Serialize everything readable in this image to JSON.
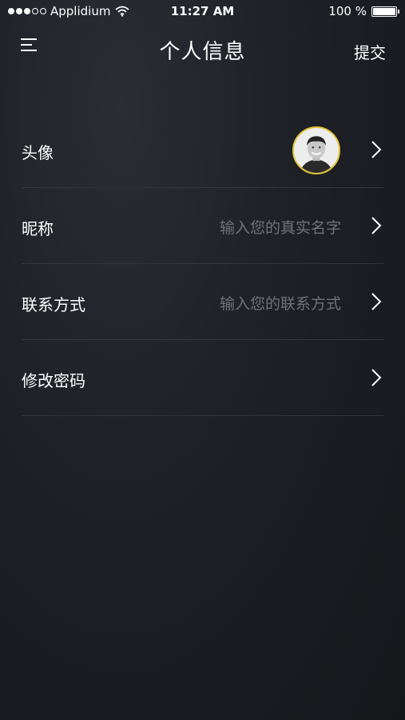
{
  "status_bar": {
    "carrier": "Applidium",
    "time": "11:27 AM",
    "battery": "100 %"
  },
  "nav": {
    "title": "个人信息",
    "submit_label": "提交",
    "menu_icon": "hamburger-icon"
  },
  "rows": [
    {
      "label": "头像",
      "value": "",
      "type": "avatar"
    },
    {
      "label": "昵称",
      "placeholder": "输入您的真实名字"
    },
    {
      "label": "联系方式",
      "placeholder": "输入您的联系方式"
    },
    {
      "label": "修改密码",
      "value": ""
    }
  ],
  "colors": {
    "accent": "#e4c233",
    "placeholder": "#6f7277",
    "divider": "#33363c"
  }
}
